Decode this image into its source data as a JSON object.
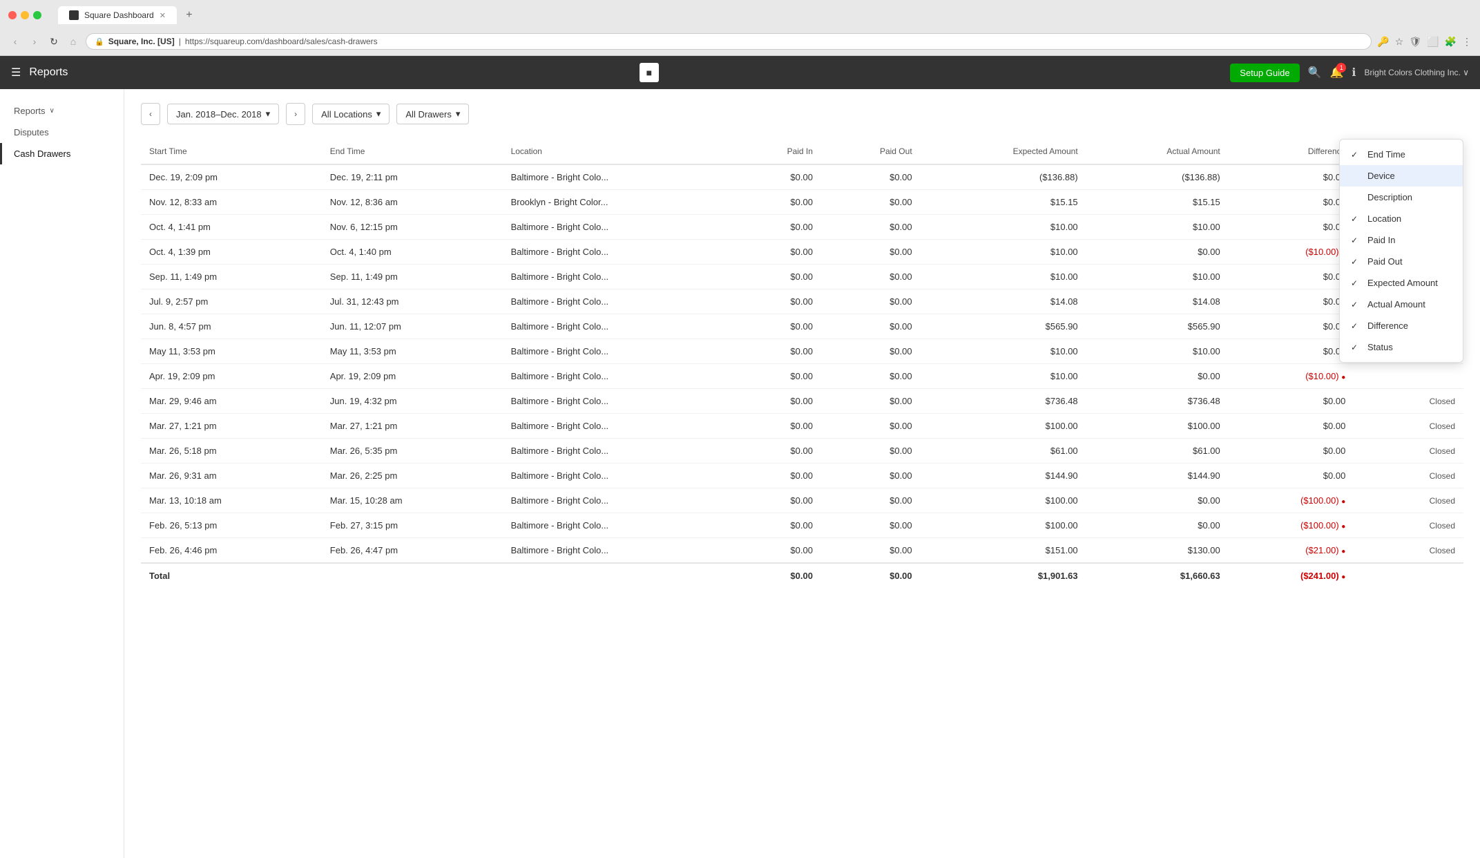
{
  "browser": {
    "tab_title": "Square Dashboard",
    "url_domain": "Square, Inc. [US]",
    "url_full": "https://squareup.com/dashboard/sales/cash-drawers",
    "nav_back": "‹",
    "nav_forward": "›",
    "nav_refresh": "↻",
    "nav_home": "⌂",
    "new_tab": "+"
  },
  "header": {
    "menu_icon": "☰",
    "title": "Reports",
    "setup_guide": "Setup Guide",
    "square_logo": "■",
    "search_icon": "🔍",
    "bell_icon": "🔔",
    "notification_count": "1",
    "info_icon": "ℹ",
    "user_name": "Bright Colors Clothing Inc. ∨",
    "user_avatar": "👤"
  },
  "sidebar": {
    "reports_label": "Reports",
    "reports_arrow": "∨",
    "disputes_label": "Disputes",
    "cash_drawers_label": "Cash Drawers"
  },
  "toolbar": {
    "prev_btn": "‹",
    "next_btn": "›",
    "date_range": "Jan. 2018–Dec. 2018",
    "date_caret": "▾",
    "all_locations": "All Locations",
    "locations_caret": "▾",
    "all_drawers": "All Drawers",
    "drawers_caret": "▾"
  },
  "table": {
    "columns": [
      {
        "id": "start_time",
        "label": "Start Time",
        "numeric": false
      },
      {
        "id": "end_time",
        "label": "End Time",
        "numeric": false
      },
      {
        "id": "location",
        "label": "Location",
        "numeric": false
      },
      {
        "id": "paid_in",
        "label": "Paid In",
        "numeric": true
      },
      {
        "id": "paid_out",
        "label": "Paid Out",
        "numeric": true
      },
      {
        "id": "expected_amount",
        "label": "Expected Amount",
        "numeric": true
      },
      {
        "id": "actual_amount",
        "label": "Actual Amount",
        "numeric": true
      },
      {
        "id": "difference",
        "label": "Difference",
        "numeric": true
      },
      {
        "id": "status",
        "label": "Status",
        "numeric": true,
        "has_settings": true
      }
    ],
    "rows": [
      {
        "start_time": "Dec. 19, 2:09 pm",
        "end_time": "Dec. 19, 2:11 pm",
        "location": "Baltimore - Bright Colo...",
        "paid_in": "$0.00",
        "paid_out": "$0.00",
        "expected_amount": "($136.88)",
        "actual_amount": "($136.88)",
        "difference": "$0.00",
        "status": "",
        "diff_flag": false
      },
      {
        "start_time": "Nov. 12, 8:33 am",
        "end_time": "Nov. 12, 8:36 am",
        "location": "Brooklyn - Bright Color...",
        "paid_in": "$0.00",
        "paid_out": "$0.00",
        "expected_amount": "$15.15",
        "actual_amount": "$15.15",
        "difference": "$0.00",
        "status": "",
        "diff_flag": false
      },
      {
        "start_time": "Oct. 4, 1:41 pm",
        "end_time": "Nov. 6, 12:15 pm",
        "location": "Baltimore - Bright Colo...",
        "paid_in": "$0.00",
        "paid_out": "$0.00",
        "expected_amount": "$10.00",
        "actual_amount": "$10.00",
        "difference": "$0.00",
        "status": "",
        "diff_flag": false
      },
      {
        "start_time": "Oct. 4, 1:39 pm",
        "end_time": "Oct. 4, 1:40 pm",
        "location": "Baltimore - Bright Colo...",
        "paid_in": "$0.00",
        "paid_out": "$0.00",
        "expected_amount": "$10.00",
        "actual_amount": "$0.00",
        "difference": "($10.00)",
        "status": "",
        "diff_flag": true
      },
      {
        "start_time": "Sep. 11, 1:49 pm",
        "end_time": "Sep. 11, 1:49 pm",
        "location": "Baltimore - Bright Colo...",
        "paid_in": "$0.00",
        "paid_out": "$0.00",
        "expected_amount": "$10.00",
        "actual_amount": "$10.00",
        "difference": "$0.00",
        "status": "",
        "diff_flag": false
      },
      {
        "start_time": "Jul. 9, 2:57 pm",
        "end_time": "Jul. 31, 12:43 pm",
        "location": "Baltimore - Bright Colo...",
        "paid_in": "$0.00",
        "paid_out": "$0.00",
        "expected_amount": "$14.08",
        "actual_amount": "$14.08",
        "difference": "$0.00",
        "status": "",
        "diff_flag": false
      },
      {
        "start_time": "Jun. 8, 4:57 pm",
        "end_time": "Jun. 11, 12:07 pm",
        "location": "Baltimore - Bright Colo...",
        "paid_in": "$0.00",
        "paid_out": "$0.00",
        "expected_amount": "$565.90",
        "actual_amount": "$565.90",
        "difference": "$0.00",
        "status": "",
        "diff_flag": false
      },
      {
        "start_time": "May 11, 3:53 pm",
        "end_time": "May 11, 3:53 pm",
        "location": "Baltimore - Bright Colo...",
        "paid_in": "$0.00",
        "paid_out": "$0.00",
        "expected_amount": "$10.00",
        "actual_amount": "$10.00",
        "difference": "$0.00",
        "status": "",
        "diff_flag": false
      },
      {
        "start_time": "Apr. 19, 2:09 pm",
        "end_time": "Apr. 19, 2:09 pm",
        "location": "Baltimore - Bright Colo...",
        "paid_in": "$0.00",
        "paid_out": "$0.00",
        "expected_amount": "$10.00",
        "actual_amount": "$0.00",
        "difference": "($10.00)",
        "status": "",
        "diff_flag": true
      },
      {
        "start_time": "Mar. 29, 9:46 am",
        "end_time": "Jun. 19, 4:32 pm",
        "location": "Baltimore - Bright Colo...",
        "paid_in": "$0.00",
        "paid_out": "$0.00",
        "expected_amount": "$736.48",
        "actual_amount": "$736.48",
        "difference": "$0.00",
        "status": "Closed",
        "diff_flag": false
      },
      {
        "start_time": "Mar. 27, 1:21 pm",
        "end_time": "Mar. 27, 1:21 pm",
        "location": "Baltimore - Bright Colo...",
        "paid_in": "$0.00",
        "paid_out": "$0.00",
        "expected_amount": "$100.00",
        "actual_amount": "$100.00",
        "difference": "$0.00",
        "status": "Closed",
        "diff_flag": false
      },
      {
        "start_time": "Mar. 26, 5:18 pm",
        "end_time": "Mar. 26, 5:35 pm",
        "location": "Baltimore - Bright Colo...",
        "paid_in": "$0.00",
        "paid_out": "$0.00",
        "expected_amount": "$61.00",
        "actual_amount": "$61.00",
        "difference": "$0.00",
        "status": "Closed",
        "diff_flag": false
      },
      {
        "start_time": "Mar. 26, 9:31 am",
        "end_time": "Mar. 26, 2:25 pm",
        "location": "Baltimore - Bright Colo...",
        "paid_in": "$0.00",
        "paid_out": "$0.00",
        "expected_amount": "$144.90",
        "actual_amount": "$144.90",
        "difference": "$0.00",
        "status": "Closed",
        "diff_flag": false
      },
      {
        "start_time": "Mar. 13, 10:18 am",
        "end_time": "Mar. 15, 10:28 am",
        "location": "Baltimore - Bright Colo...",
        "paid_in": "$0.00",
        "paid_out": "$0.00",
        "expected_amount": "$100.00",
        "actual_amount": "$0.00",
        "difference": "($100.00)",
        "status": "Closed",
        "diff_flag": true
      },
      {
        "start_time": "Feb. 26, 5:13 pm",
        "end_time": "Feb. 27, 3:15 pm",
        "location": "Baltimore - Bright Colo...",
        "paid_in": "$0.00",
        "paid_out": "$0.00",
        "expected_amount": "$100.00",
        "actual_amount": "$0.00",
        "difference": "($100.00)",
        "status": "Closed",
        "diff_flag": true
      },
      {
        "start_time": "Feb. 26, 4:46 pm",
        "end_time": "Feb. 26, 4:47 pm",
        "location": "Baltimore - Bright Colo...",
        "paid_in": "$0.00",
        "paid_out": "$0.00",
        "expected_amount": "$151.00",
        "actual_amount": "$130.00",
        "difference": "($21.00)",
        "status": "Closed",
        "diff_flag": true
      }
    ],
    "footer": {
      "label": "Total",
      "paid_in": "$0.00",
      "paid_out": "$0.00",
      "expected_amount": "$1,901.63",
      "actual_amount": "$1,660.63",
      "difference": "($241.00)",
      "diff_flag": true
    }
  },
  "col_dropdown": {
    "items": [
      {
        "label": "End Time",
        "checked": true,
        "highlighted": false
      },
      {
        "label": "Device",
        "checked": false,
        "highlighted": true
      },
      {
        "label": "Description",
        "checked": false,
        "highlighted": false
      },
      {
        "label": "Location",
        "checked": true,
        "highlighted": false
      },
      {
        "label": "Paid In",
        "checked": true,
        "highlighted": false
      },
      {
        "label": "Paid Out",
        "checked": true,
        "highlighted": false
      },
      {
        "label": "Expected Amount",
        "checked": true,
        "highlighted": false
      },
      {
        "label": "Actual Amount",
        "checked": true,
        "highlighted": false
      },
      {
        "label": "Difference",
        "checked": true,
        "highlighted": false
      },
      {
        "label": "Status",
        "checked": true,
        "highlighted": false
      }
    ]
  }
}
